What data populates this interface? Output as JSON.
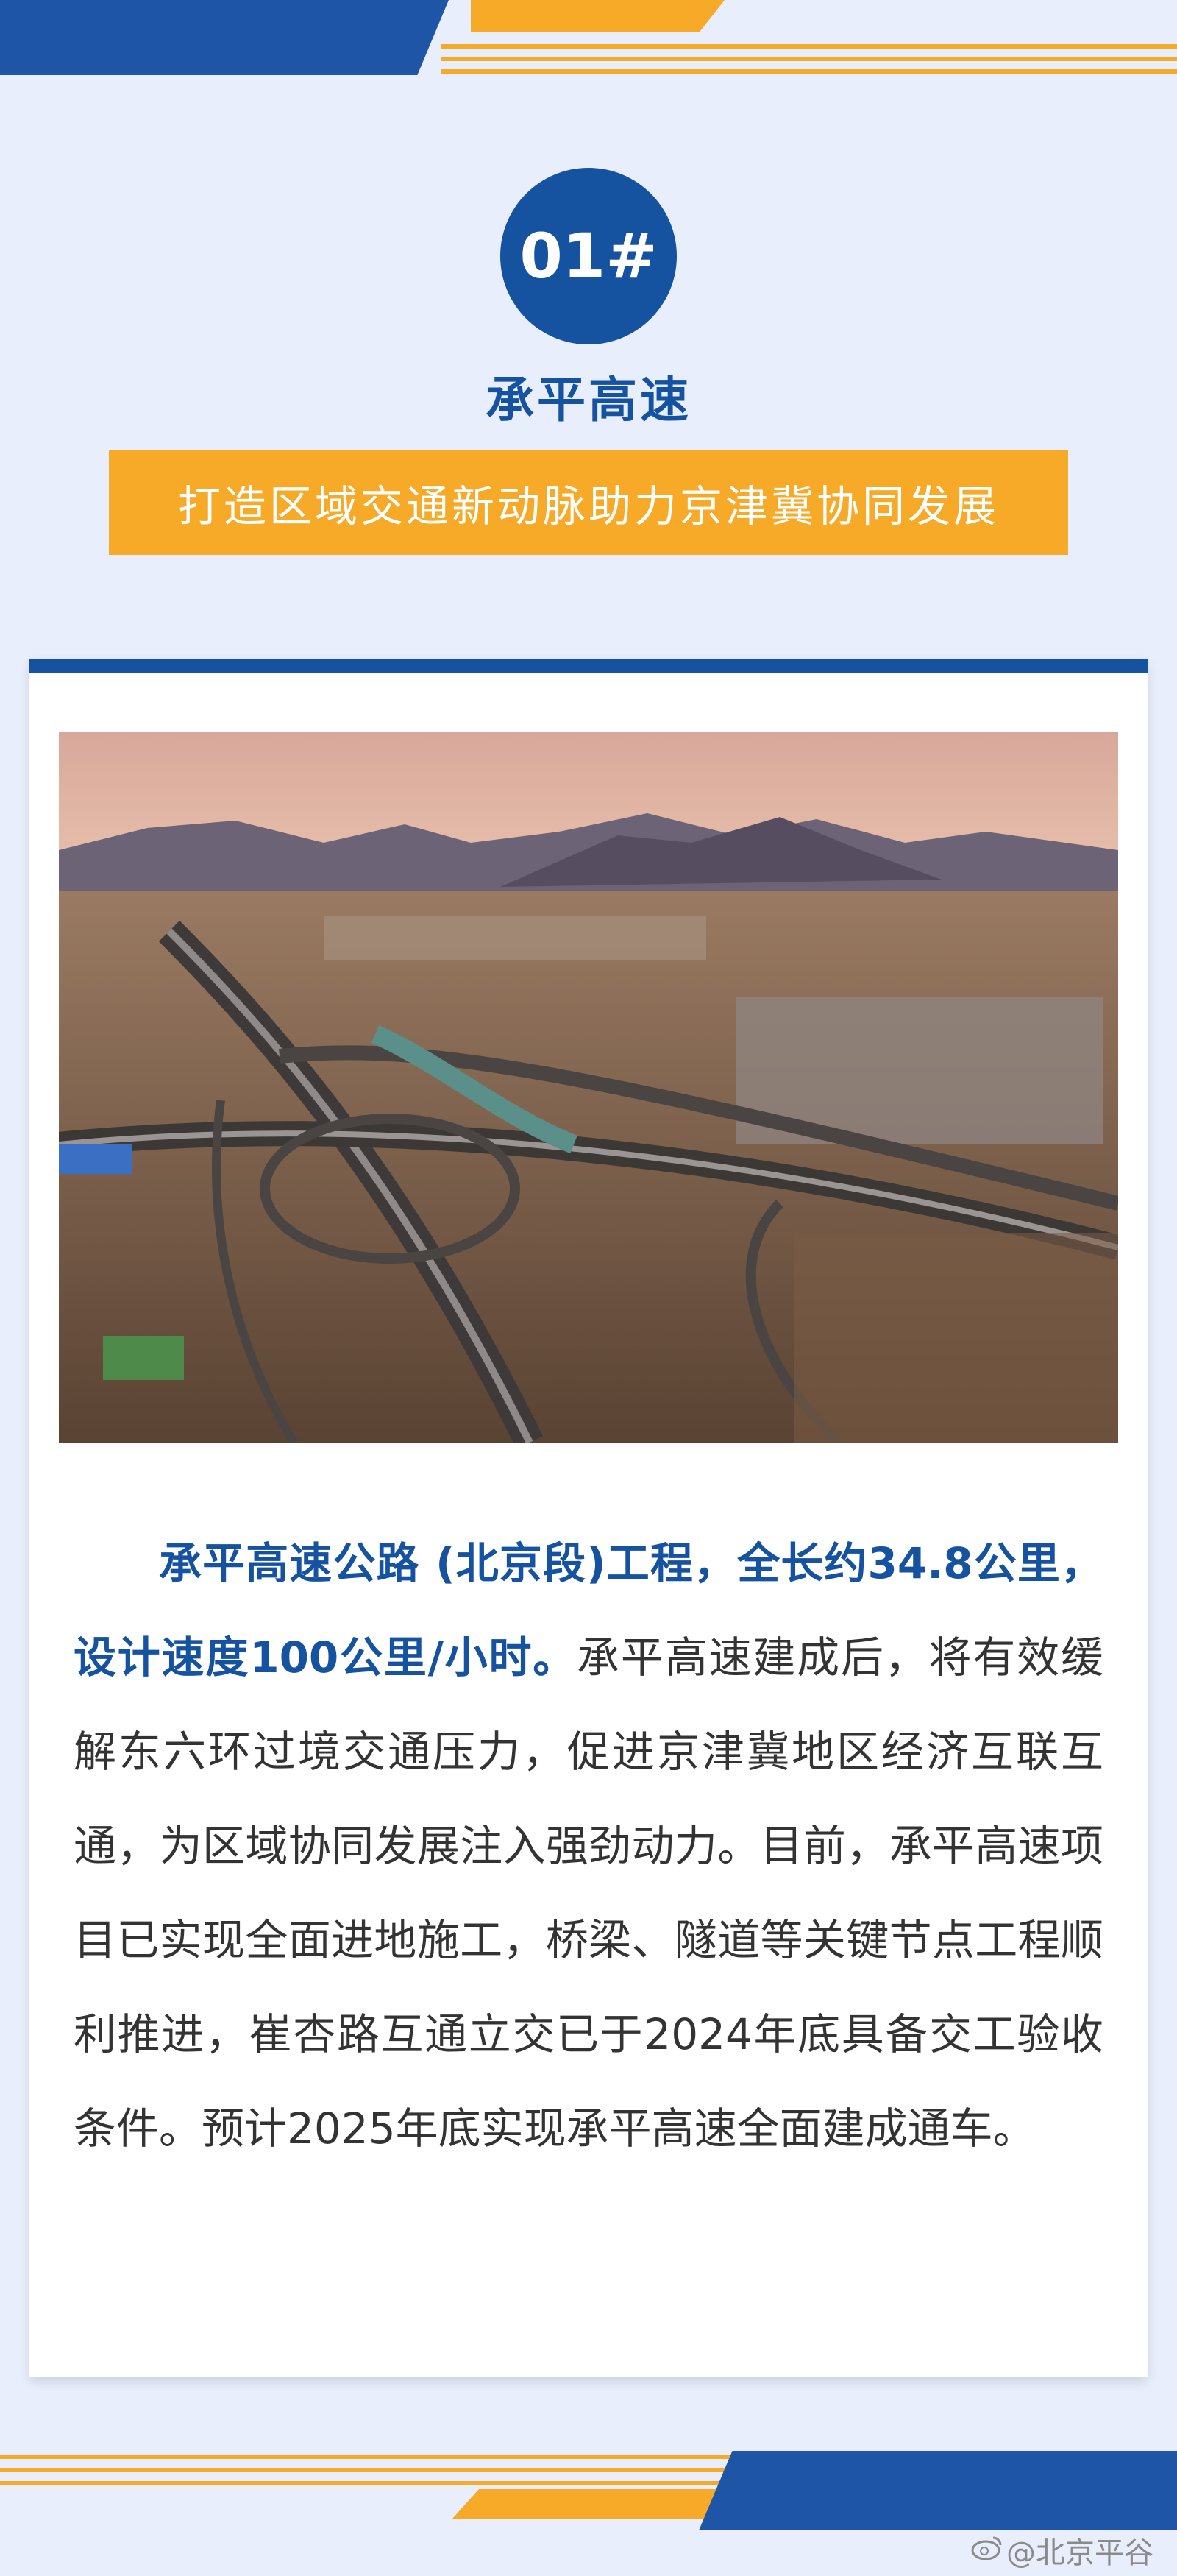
{
  "badge": {
    "text": "01#"
  },
  "title": "承平高速",
  "subtitle": "打造区域交通新动脉助力京津冀协同发展",
  "article": {
    "highlight": "承平高速公路 (北京段)工程，全长约34.8公里，设计速度100公里/小时。",
    "body": "承平高速建成后，将有效缓解东六环过境交通压力，促进京津冀地区经济互联互通，为区域协同发展注入强劲动力。目前，承平高速项目已实现全面进地施工，桥梁、隧道等关键节点工程顺利推进，崔杏路互通立交已于2024年底具备交工验收条件。预计2025年底实现承平高速全面建成通车。"
  },
  "watermark": {
    "icon": "weibo-icon",
    "text": "@北京平谷"
  },
  "colors": {
    "blue": "#1552a0",
    "orange": "#f7a928",
    "background": "#e9eefc"
  }
}
